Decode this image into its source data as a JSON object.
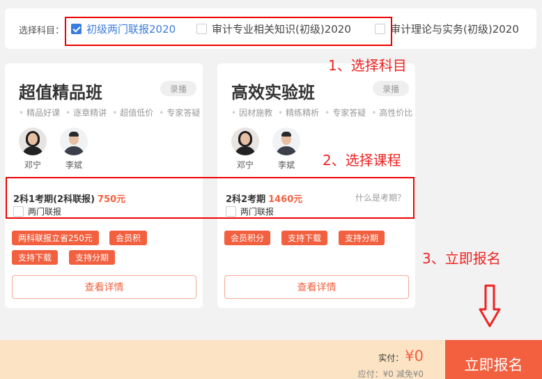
{
  "subject_bar": {
    "label": "选择科目：",
    "options": [
      {
        "label": "初级两门联报2020",
        "checked": true
      },
      {
        "label": "审计专业相关知识(初级)2020",
        "checked": false
      },
      {
        "label": "审计理论与实务(初级)2020",
        "checked": false
      }
    ]
  },
  "cards": [
    {
      "title": "超值精品班",
      "badge": "录播",
      "features": [
        "精品好课",
        "逐章精讲",
        "超值低价",
        "专家答疑"
      ],
      "teachers": [
        "邓宁",
        "李斌"
      ],
      "period": "2科1考期(2科联报)",
      "price": "750元",
      "joint_label": "两门联报",
      "tags": [
        "两科联报立省250元",
        "会员积",
        "支持下载",
        "支持分期"
      ],
      "detail_label": "查看详情"
    },
    {
      "title": "高效实验班",
      "badge": "录播",
      "features": [
        "因材施教",
        "精练精析",
        "专家答疑",
        "高性价比"
      ],
      "teachers": [
        "邓宁",
        "李斌"
      ],
      "period": "2科2考期",
      "price": "1460元",
      "what_is": "什么是考期？",
      "joint_label": "两门联报",
      "tags": [
        "会员积分",
        "支持下载",
        "支持分期"
      ],
      "detail_label": "查看详情"
    }
  ],
  "annotations": {
    "step1": "1、选择科目",
    "step2": "2、选择课程",
    "step3": "3、立即报名"
  },
  "footer": {
    "paid_label": "实付：",
    "paid_value": "¥0",
    "sub": "应付：¥0    减免¥0",
    "signup_label": "立即报名"
  },
  "colors": {
    "accent": "#f2603f",
    "selected": "#3b7ddd",
    "annotation": "#ee2222",
    "footer_bg": "#fbe3c4"
  }
}
